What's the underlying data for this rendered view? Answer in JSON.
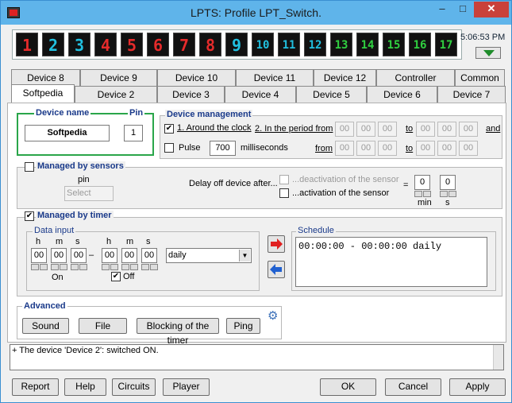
{
  "window": {
    "title": "LPTS: Profile LPT_Switch.",
    "min": "–",
    "max": "□",
    "close": "✕"
  },
  "digits": [
    {
      "label": "1",
      "color": "#e52b2b"
    },
    {
      "label": "2",
      "color": "#21c0e0"
    },
    {
      "label": "3",
      "color": "#21c0e0"
    },
    {
      "label": "4",
      "color": "#e52b2b"
    },
    {
      "label": "5",
      "color": "#e52b2b"
    },
    {
      "label": "6",
      "color": "#e52b2b"
    },
    {
      "label": "7",
      "color": "#e52b2b"
    },
    {
      "label": "8",
      "color": "#e52b2b"
    },
    {
      "label": "9",
      "color": "#21c0e0"
    },
    {
      "label": "10",
      "color": "#21c0e0"
    },
    {
      "label": "11",
      "color": "#21c0e0"
    },
    {
      "label": "12",
      "color": "#21c0e0"
    },
    {
      "label": "13",
      "color": "#30d040"
    },
    {
      "label": "14",
      "color": "#30d040"
    },
    {
      "label": "15",
      "color": "#30d040"
    },
    {
      "label": "16",
      "color": "#30d040"
    },
    {
      "label": "17",
      "color": "#30d040"
    }
  ],
  "clock": "5:06:53 PM",
  "tabs_top": [
    "Device 8",
    "Device 9",
    "Device 10",
    "Device 11",
    "Device 12",
    "Controller",
    "Common"
  ],
  "tabs_bottom": [
    "Softpedia",
    "Device 2",
    "Device 3",
    "Device 4",
    "Device 5",
    "Device 6",
    "Device 7"
  ],
  "device": {
    "name_label": "Device name",
    "pin_label": "Pin",
    "name_value": "Softpedia",
    "pin_value": "1"
  },
  "management": {
    "title": "Device management",
    "around": "1. Around the clock",
    "period": "2. In the period from",
    "to": "to",
    "and": "and",
    "pulse": "Pulse",
    "pulse_value": "700",
    "ms": "milliseconds",
    "from": "from",
    "time": "00"
  },
  "sensors": {
    "title": "Managed by sensors",
    "pin": "pin",
    "select": "Select",
    "delay": "Delay off device after...",
    "deact": "...deactivation of the sensor",
    "act": "...activation of the sensor",
    "eq": "=",
    "min_val": "0",
    "sec_val": "0",
    "min": "min",
    "sec": "s"
  },
  "timer": {
    "title": "Managed by timer",
    "input_title": "Data input",
    "h": "h",
    "m": "m",
    "s": "s",
    "zero": "00",
    "dash": "–",
    "on": "On",
    "off": "Off",
    "freq": "daily",
    "schedule_title": "Schedule",
    "schedule_entry": "00:00:00 - 00:00:00 daily"
  },
  "advanced": {
    "title": "Advanced",
    "sound": "Sound",
    "file": "File",
    "blocking": "Blocking of the timer",
    "ping": "Ping"
  },
  "log": "+ The device 'Device 2': switched ON.",
  "footer": {
    "report": "Report",
    "help": "Help",
    "circuits": "Circuits",
    "player": "Player",
    "ok": "OK",
    "cancel": "Cancel",
    "apply": "Apply"
  }
}
